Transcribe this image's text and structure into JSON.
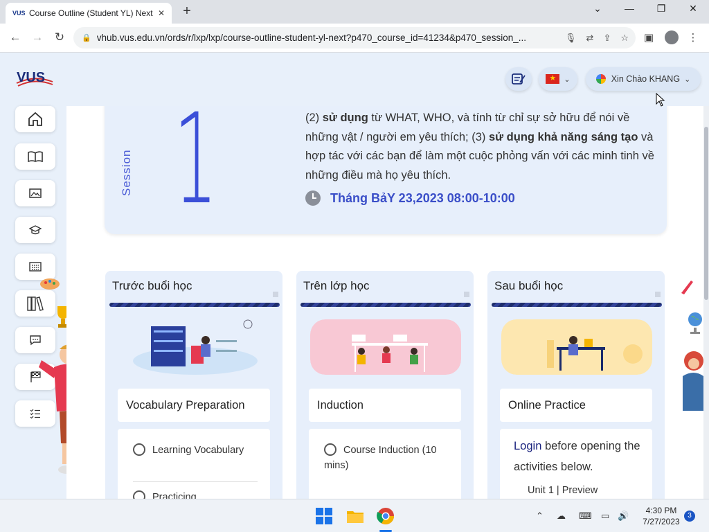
{
  "browser": {
    "tab_title": "Course Outline (Student YL) Next",
    "tab_favicon": "VUS",
    "url": "vhub.vus.edu.vn/ords/r/lxp/lxp/course-outline-student-yl-next?p470_course_id=41234&p470_session_..."
  },
  "header": {
    "logo_text": "VUS",
    "greeting": "Xin Chào KHANG"
  },
  "session": {
    "label": "Session",
    "number": "1",
    "desc_part1": "(2) ",
    "desc_bold1": "sử dụng",
    "desc_part2": " từ WHAT, WHO, và tính từ chỉ sự sở hữu để nói về những vật / người em yêu thích; (3) ",
    "desc_bold2": "sử dụng khả năng sáng tạo",
    "desc_part3": " và hợp tác với các bạn để làm một cuộc phỏng vấn với các minh tinh về những điều mà họ yêu thích.",
    "datetime": "Tháng BảY 23,2023 08:00-10:00"
  },
  "phases": [
    {
      "title": "Trước buổi học",
      "activity": "Vocabulary Preparation",
      "items": [
        "Learning Vocabulary",
        "Practicing"
      ]
    },
    {
      "title": "Trên lớp học",
      "activity": "Induction",
      "items": [
        "Course Induction (10 mins)"
      ]
    },
    {
      "title": "Sau buổi học",
      "activity": "Online Practice",
      "login_link": "Login",
      "login_text": " before opening the activities below.",
      "unit_item": "Unit 1 | Preview"
    }
  ],
  "taskbar": {
    "time": "4:30 PM",
    "date": "7/27/2023",
    "notifications": "3"
  },
  "colors": {
    "accent": "#3b4fd8",
    "page_bg": "#e8f0fa",
    "card_bg": "#e7effb",
    "stripe": "#1f2e6b"
  }
}
